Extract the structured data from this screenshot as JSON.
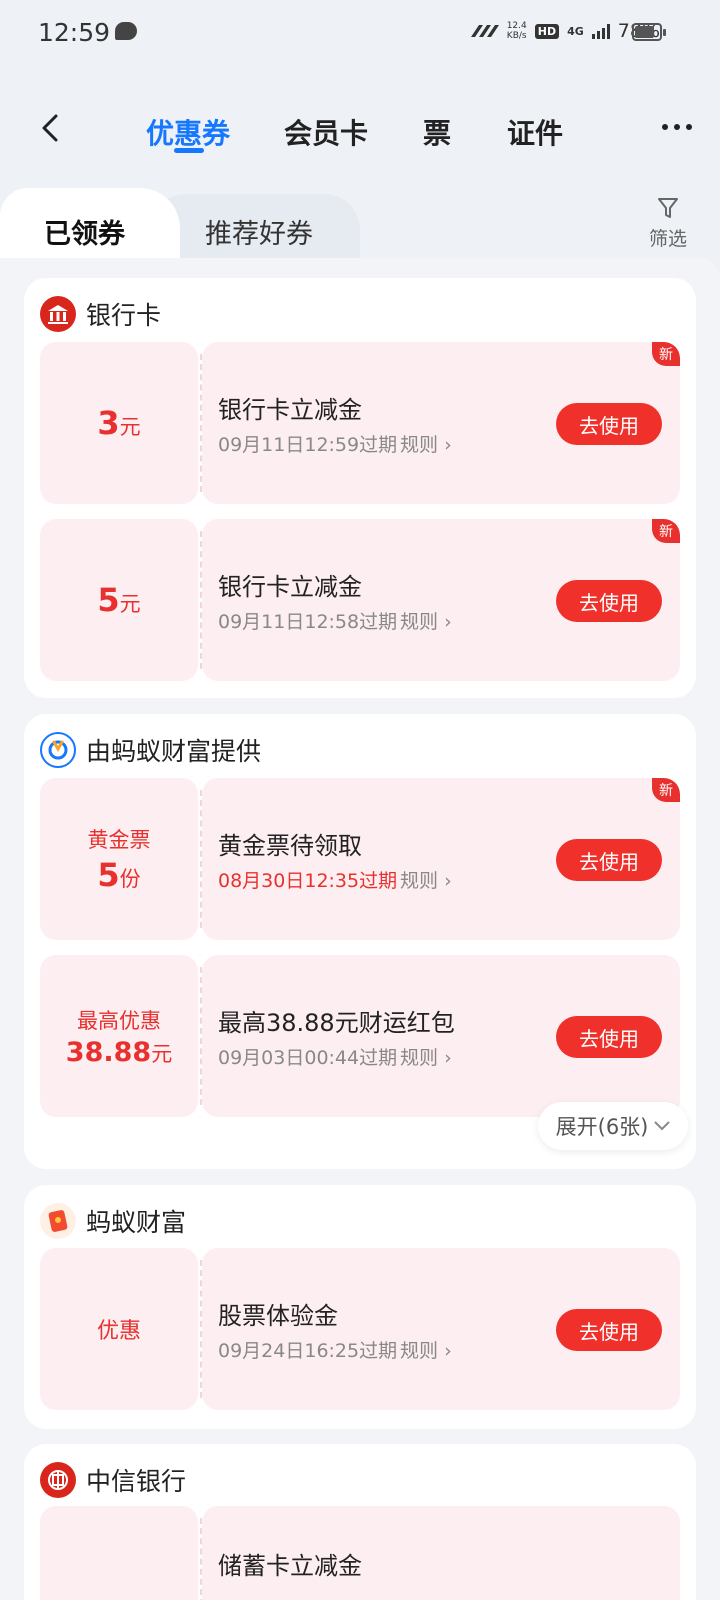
{
  "status_bar": {
    "time": "12:59",
    "speed_top": "12.4",
    "speed_bottom": "KB/s",
    "hd": "HD",
    "network": "4G",
    "battery": "78%"
  },
  "nav": {
    "tabs": [
      {
        "label": "优惠券"
      },
      {
        "label": "会员卡"
      },
      {
        "label": "票"
      },
      {
        "label": "证件"
      }
    ]
  },
  "sub_tabs": {
    "active": "已领券",
    "inactive": "推荐好券",
    "filter_label": "筛选"
  },
  "sections": [
    {
      "title": "银行卡",
      "coupons": [
        {
          "amount": "3",
          "unit": "元",
          "name": "银行卡立减金",
          "expiry": "09月11日12:59过期",
          "rules": "规则",
          "button": "去使用",
          "badge": "新"
        },
        {
          "amount": "5",
          "unit": "元",
          "name": "银行卡立减金",
          "expiry": "09月11日12:58过期",
          "rules": "规则",
          "button": "去使用",
          "badge": "新"
        }
      ]
    },
    {
      "title": "由蚂蚁财富提供",
      "coupons": [
        {
          "top_label": "黄金票",
          "amount": "5",
          "unit": "份",
          "name": "黄金票待领取",
          "expiry": "08月30日12:35过期",
          "rules": "规则",
          "button": "去使用",
          "badge": "新"
        },
        {
          "top_label": "最高优惠",
          "amount": "38.88",
          "unit": "元",
          "name": "最高38.88元财运红包",
          "expiry": "09月03日00:44过期",
          "rules": "规则",
          "button": "去使用"
        }
      ],
      "expand_label": "展开(6张)"
    },
    {
      "title": "蚂蚁财富",
      "coupons": [
        {
          "word": "优惠",
          "name": "股票体验金",
          "expiry": "09月24日16:25过期",
          "rules": "规则",
          "button": "去使用"
        }
      ]
    },
    {
      "title": "中信银行",
      "coupons": [
        {
          "name": "储蓄卡立减金"
        }
      ]
    }
  ],
  "colors": {
    "accent_blue": "#1677ff",
    "coupon_red": "#e8312e",
    "coupon_bg": "#fdeff1",
    "button_red": "#f0302a"
  }
}
